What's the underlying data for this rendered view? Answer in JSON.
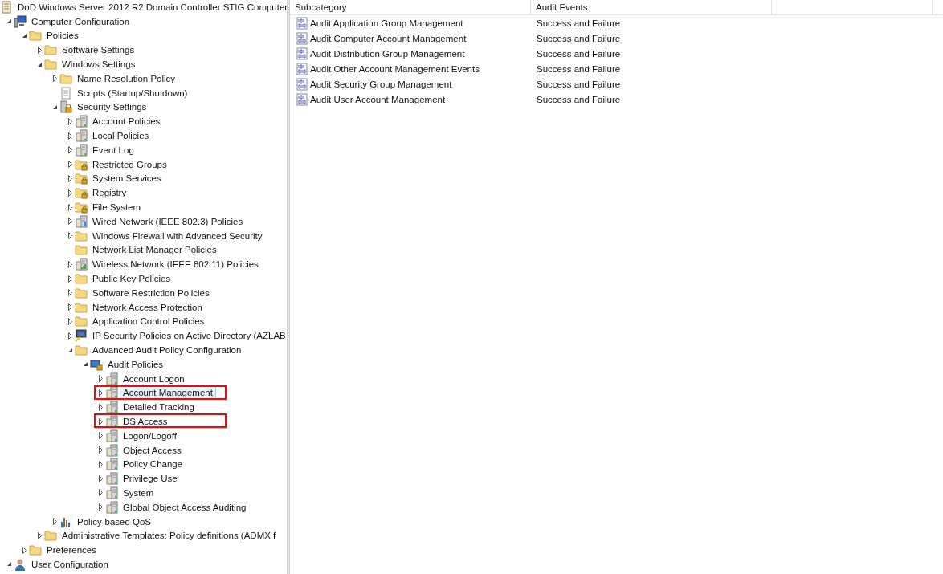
{
  "tree": {
    "label": "DoD Windows Server 2012 R2 Domain Controller STIG Computer",
    "kind": "doc",
    "selected": false,
    "marked": false,
    "children": [
      {
        "label": "Computer Configuration",
        "kind": "computer",
        "expanded": true,
        "selected": false,
        "marked": false,
        "children": [
          {
            "label": "Policies",
            "kind": "folder",
            "expanded": true,
            "selected": false,
            "marked": false,
            "children": [
              {
                "label": "Software Settings",
                "kind": "folder",
                "expanded": false,
                "selected": false,
                "marked": false
              },
              {
                "label": "Windows Settings",
                "kind": "folder",
                "expanded": true,
                "selected": false,
                "marked": false,
                "children": [
                  {
                    "label": "Name Resolution Policy",
                    "kind": "folder",
                    "expanded": false,
                    "selected": false,
                    "marked": false
                  },
                  {
                    "label": "Scripts (Startup/Shutdown)",
                    "kind": "script",
                    "selected": false,
                    "marked": false
                  },
                  {
                    "label": "Security Settings",
                    "kind": "security",
                    "expanded": true,
                    "selected": false,
                    "marked": false,
                    "children": [
                      {
                        "label": "Account Policies",
                        "kind": "server",
                        "expanded": false,
                        "selected": false,
                        "marked": false
                      },
                      {
                        "label": "Local Policies",
                        "kind": "server",
                        "expanded": false,
                        "selected": false,
                        "marked": false
                      },
                      {
                        "label": "Event Log",
                        "kind": "server",
                        "expanded": false,
                        "selected": false,
                        "marked": false
                      },
                      {
                        "label": "Restricted Groups",
                        "kind": "folder-lock",
                        "expanded": false,
                        "selected": false,
                        "marked": false
                      },
                      {
                        "label": "System Services",
                        "kind": "folder-lock",
                        "expanded": false,
                        "selected": false,
                        "marked": false
                      },
                      {
                        "label": "Registry",
                        "kind": "folder-lock",
                        "expanded": false,
                        "selected": false,
                        "marked": false
                      },
                      {
                        "label": "File System",
                        "kind": "folder-lock",
                        "expanded": false,
                        "selected": false,
                        "marked": false
                      },
                      {
                        "label": "Wired Network (IEEE 802.3) Policies",
                        "kind": "wired",
                        "expanded": false,
                        "selected": false,
                        "marked": false
                      },
                      {
                        "label": "Windows Firewall with Advanced Security",
                        "kind": "folder",
                        "expanded": false,
                        "selected": false,
                        "marked": false
                      },
                      {
                        "label": "Network List Manager Policies",
                        "kind": "folder",
                        "selected": false,
                        "marked": false
                      },
                      {
                        "label": "Wireless Network (IEEE 802.11) Policies",
                        "kind": "wireless",
                        "expanded": false,
                        "selected": false,
                        "marked": false
                      },
                      {
                        "label": "Public Key Policies",
                        "kind": "folder",
                        "expanded": false,
                        "selected": false,
                        "marked": false
                      },
                      {
                        "label": "Software Restriction Policies",
                        "kind": "folder",
                        "expanded": false,
                        "selected": false,
                        "marked": false
                      },
                      {
                        "label": "Network Access Protection",
                        "kind": "folder",
                        "expanded": false,
                        "selected": false,
                        "marked": false
                      },
                      {
                        "label": "Application Control Policies",
                        "kind": "folder",
                        "expanded": false,
                        "selected": false,
                        "marked": false
                      },
                      {
                        "label": "IP Security Policies on Active Directory (AZLAB",
                        "kind": "ipsec",
                        "expanded": false,
                        "selected": false,
                        "marked": false
                      },
                      {
                        "label": "Advanced Audit Policy Configuration",
                        "kind": "folder",
                        "expanded": true,
                        "selected": false,
                        "marked": false,
                        "children": [
                          {
                            "label": "Audit Policies",
                            "kind": "audit",
                            "expanded": true,
                            "selected": false,
                            "marked": false,
                            "children": [
                              {
                                "label": "Account Logon",
                                "kind": "server",
                                "expanded": false,
                                "selected": false,
                                "marked": false
                              },
                              {
                                "label": "Account Management",
                                "kind": "server",
                                "expanded": false,
                                "selected": true,
                                "marked": true
                              },
                              {
                                "label": "Detailed Tracking",
                                "kind": "server",
                                "expanded": false,
                                "selected": false,
                                "marked": false
                              },
                              {
                                "label": "DS Access",
                                "kind": "server",
                                "expanded": false,
                                "selected": false,
                                "marked": true
                              },
                              {
                                "label": "Logon/Logoff",
                                "kind": "server",
                                "expanded": false,
                                "selected": false,
                                "marked": false
                              },
                              {
                                "label": "Object Access",
                                "kind": "server",
                                "expanded": false,
                                "selected": false,
                                "marked": false
                              },
                              {
                                "label": "Policy Change",
                                "kind": "server",
                                "expanded": false,
                                "selected": false,
                                "marked": false
                              },
                              {
                                "label": "Privilege Use",
                                "kind": "server",
                                "expanded": false,
                                "selected": false,
                                "marked": false
                              },
                              {
                                "label": "System",
                                "kind": "server",
                                "expanded": false,
                                "selected": false,
                                "marked": false
                              },
                              {
                                "label": "Global Object Access Auditing",
                                "kind": "server",
                                "expanded": false,
                                "selected": false,
                                "marked": false
                              }
                            ]
                          }
                        ]
                      }
                    ]
                  },
                  {
                    "label": "Policy-based QoS",
                    "kind": "qos",
                    "expanded": false,
                    "selected": false,
                    "marked": false
                  }
                ]
              },
              {
                "label": "Administrative Templates: Policy definitions (ADMX f",
                "kind": "folder",
                "expanded": false,
                "selected": false,
                "marked": false
              }
            ]
          },
          {
            "label": "Preferences",
            "kind": "folder",
            "expanded": false,
            "selected": false,
            "marked": false
          }
        ]
      },
      {
        "label": "User Configuration",
        "kind": "user",
        "expanded": true,
        "selected": false,
        "marked": false
      }
    ]
  },
  "table": {
    "columns": [
      "Subcategory",
      "Audit Events"
    ],
    "rows": [
      {
        "subcategory": "Audit Application Group Management",
        "audit_events": "Success and Failure"
      },
      {
        "subcategory": "Audit Computer Account Management",
        "audit_events": "Success and Failure"
      },
      {
        "subcategory": "Audit Distribution Group Management",
        "audit_events": "Success and Failure"
      },
      {
        "subcategory": "Audit Other Account Management Events",
        "audit_events": "Success and Failure"
      },
      {
        "subcategory": "Audit Security Group Management",
        "audit_events": "Success and Failure"
      },
      {
        "subcategory": "Audit User Account Management",
        "audit_events": "Success and Failure"
      }
    ]
  }
}
